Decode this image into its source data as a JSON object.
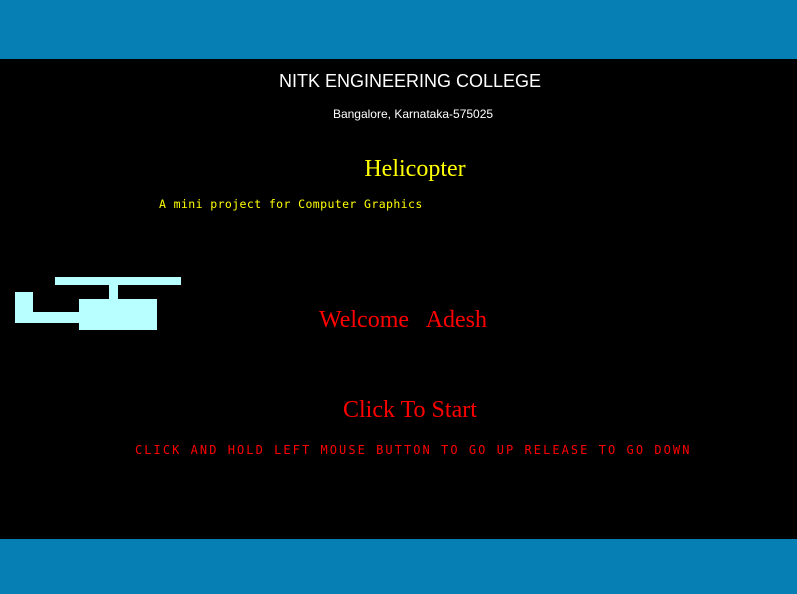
{
  "header": {
    "college": "NITK ENGINEERING COLLEGE",
    "address": "Bangalore, Karnataka-575025"
  },
  "game": {
    "title": "Helicopter",
    "subtitle": "A mini project for Computer Graphics",
    "welcome": "Welcome  Adesh",
    "start_label": "Click To Start",
    "instructions": "CLICK AND HOLD LEFT MOUSE BUTTON TO GO UP RELEASE TO GO DOWN"
  },
  "colors": {
    "band": "#0680b4",
    "background": "#000000",
    "header_text": "#ffffff",
    "title_text": "#ffff00",
    "accent_red": "#ff0000",
    "helicopter": "#b8ffff"
  },
  "icons": {
    "player": "helicopter-icon"
  }
}
